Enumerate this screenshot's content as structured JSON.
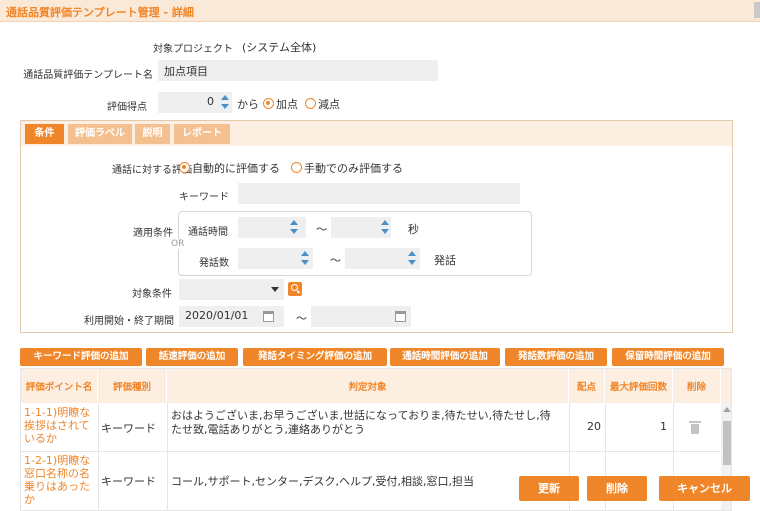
{
  "window": {
    "title": "通話品質評価テンプレート管理 - 詳細"
  },
  "form": {
    "project_label": "対象プロジェクト",
    "project_value": "(システム全体)",
    "template_label": "通話品質評価テンプレート名",
    "template_value": "加点項目",
    "score_label": "評価得点",
    "score_value": "0",
    "score_from": "から",
    "add_label": "加点",
    "sub_label": "減点"
  },
  "tabs": [
    "条件",
    "評価ラベル",
    "説明",
    "レポート"
  ],
  "conditions": {
    "eval_label": "通話に対する評価",
    "auto_label": "自動的に評価する",
    "manual_label": "手動でのみ評価する",
    "keyword_label": "キーワード",
    "apply_label": "適用条件",
    "or_label": "OR",
    "duration_label": "通話時間",
    "tilde": "〜",
    "seconds_unit": "秒",
    "utterance_label": "発話数",
    "utterance_unit": "発話",
    "target_label": "対象条件",
    "period_label": "利用開始・終了期間",
    "start_date": "2020/01/01"
  },
  "add_buttons": [
    "キーワード評価の追加",
    "話速評価の追加",
    "発話タイミング評価の追加",
    "通話時間評価の追加",
    "発話数評価の追加",
    "保留時間評価の追加"
  ],
  "table": {
    "headers": [
      "評価ポイント名",
      "評価種別",
      "判定対象",
      "配点",
      "最大評価回数",
      "削除"
    ],
    "rows": [
      {
        "name": "1-1-1)明瞭な挨拶はされているか",
        "type": "キーワード",
        "target": "おはようございま,お早うございま,世話になっておりま,待たせい,待たせし,待たせ致,電話ありがとう,連絡ありがとう",
        "score": "20",
        "max": "1"
      },
      {
        "name": "1-2-1)明瞭な窓口名称の名乗りはあったか",
        "type": "キーワード",
        "target": "コール,サポート,センター,デスク,ヘルプ,受付,相談,窓口,担当",
        "score": "",
        "max": ""
      }
    ]
  },
  "actions": {
    "update": "更新",
    "delete": "削除",
    "cancel": "キャンセル"
  },
  "colors": {
    "accent": "#f0862a",
    "accent_light": "#fcefe2",
    "spinner": "#4a90c8"
  }
}
